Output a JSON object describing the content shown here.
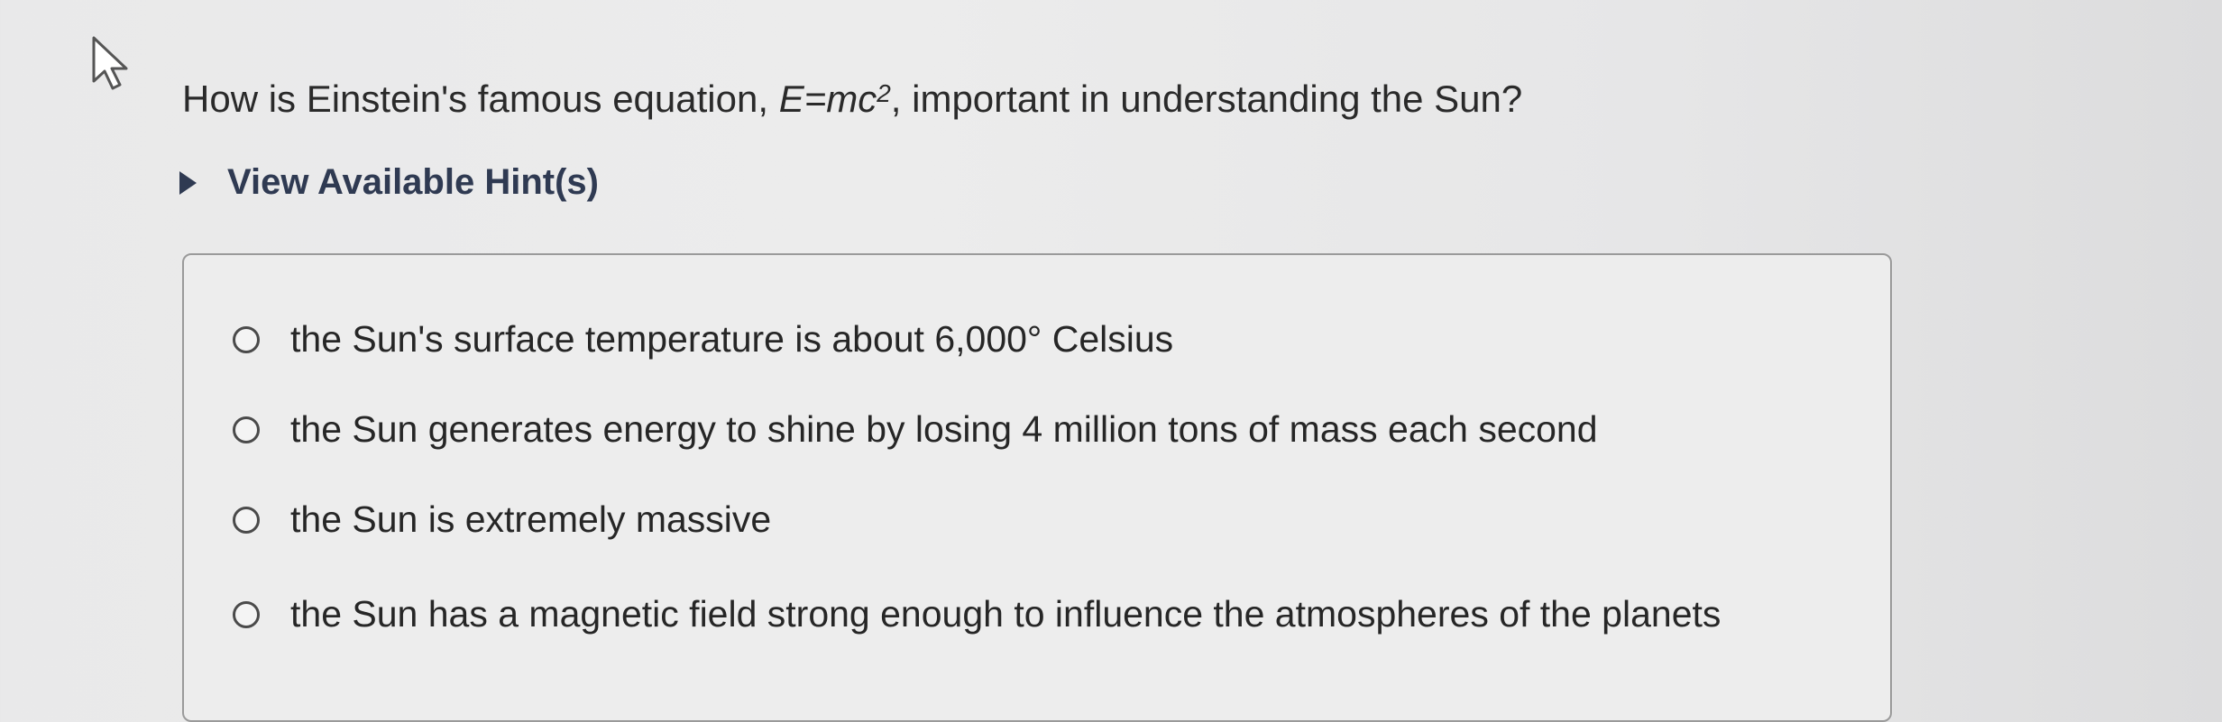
{
  "question": {
    "prefix": "How is Einstein's famous equation, ",
    "equation_base": "E=mc",
    "equation_exponent": "2",
    "suffix": ", important in understanding the Sun?"
  },
  "hints": {
    "label": "View Available Hint(s)",
    "icon": "caret-right-icon"
  },
  "choices": [
    {
      "label": "the Sun's surface temperature is about 6,000° Celsius"
    },
    {
      "label": "the Sun generates energy to shine by losing 4 million tons of mass each second"
    },
    {
      "label": "the Sun is extremely massive"
    },
    {
      "label": "the Sun has a magnetic field strong enough to influence the atmospheres of the planets"
    }
  ],
  "colors": {
    "hint_text": "#2f3a52",
    "box_border": "#9a9a9a"
  }
}
